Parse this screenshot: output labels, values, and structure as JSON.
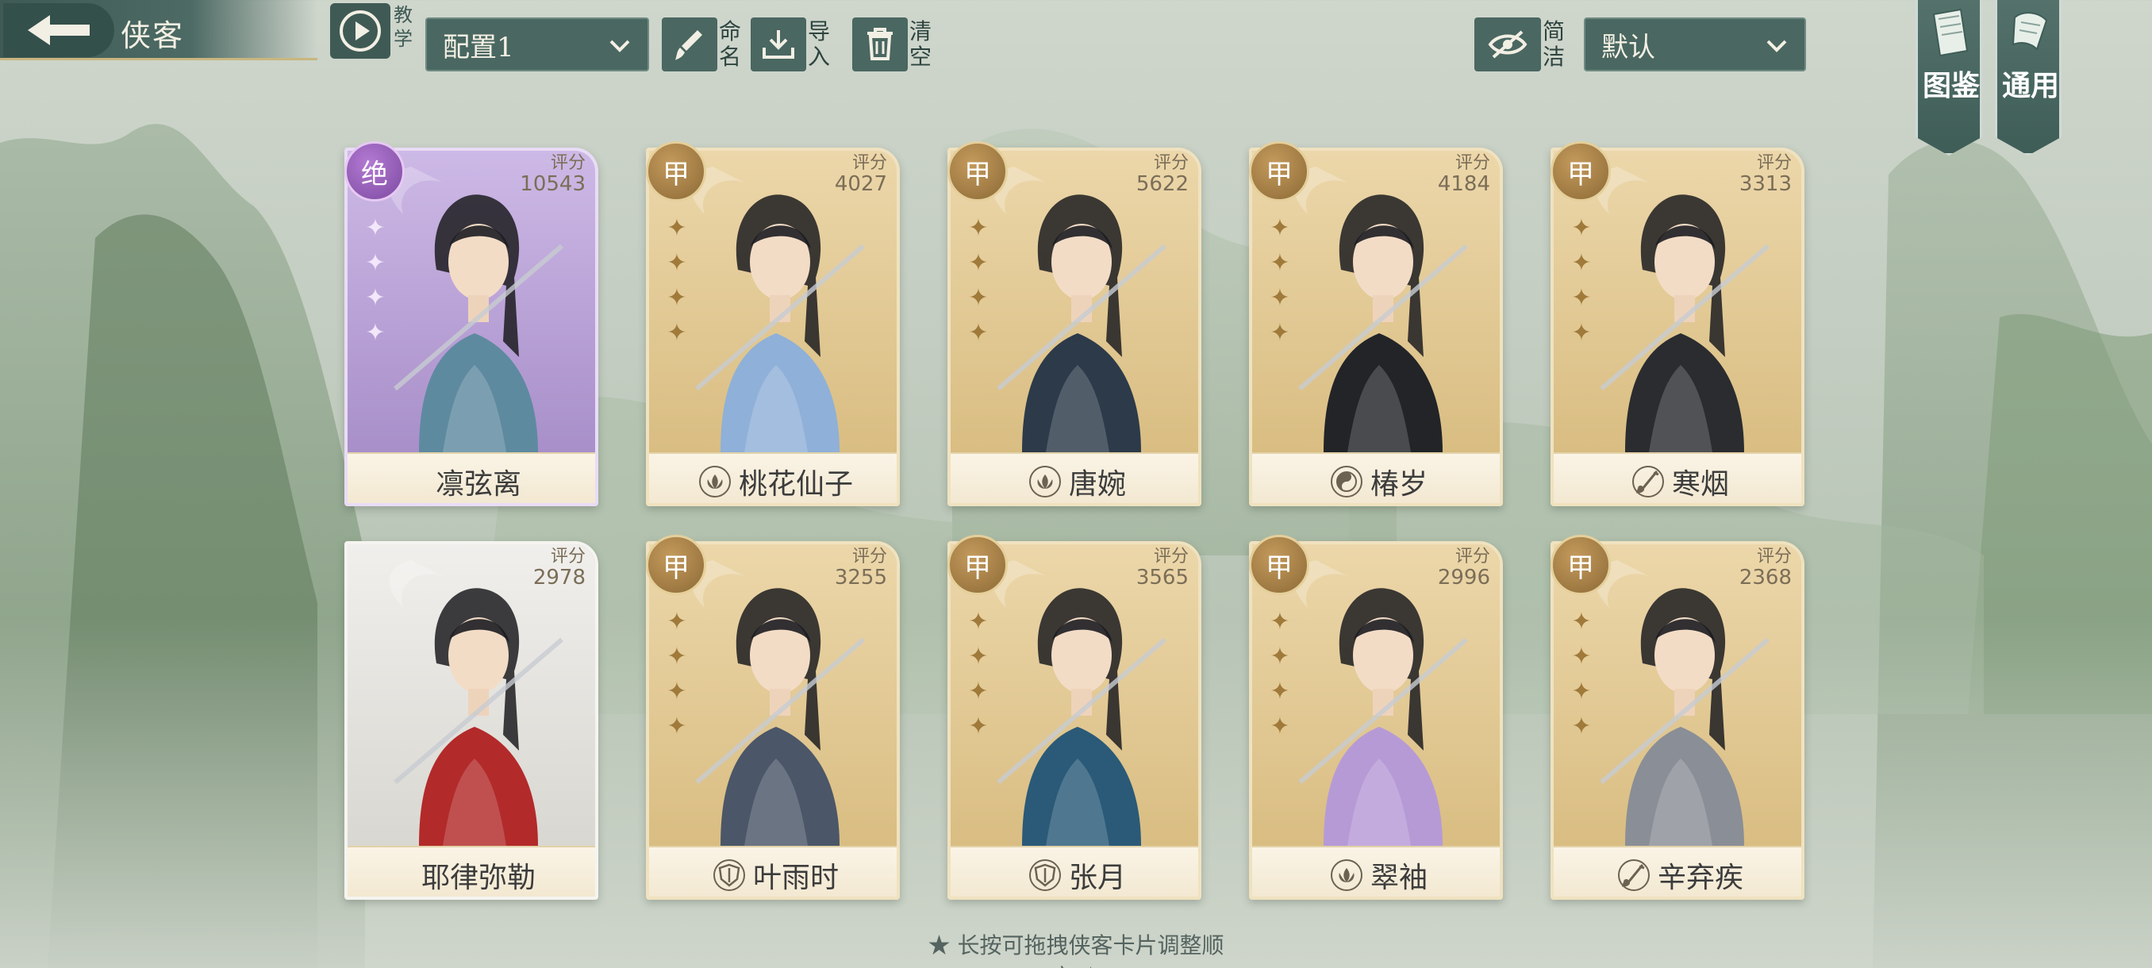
{
  "header": {
    "title": "侠客",
    "tutorial_label": "教学",
    "config_select": "配置1",
    "rename_label": "命名",
    "import_label": "导入",
    "clear_label": "清空",
    "simple_label": "简洁",
    "sort_select": "默认",
    "codex_label": "图鉴",
    "general_label": "通用"
  },
  "cards": [
    {
      "name": "凛弦离",
      "score_label": "评分",
      "score": "10543",
      "rank": "绝",
      "rank_style": "purple",
      "sect_icon": "",
      "theme": "#b9a6d6",
      "robe": "#5e8aa0"
    },
    {
      "name": "桃花仙子",
      "score_label": "评分",
      "score": "4027",
      "rank": "甲",
      "rank_style": "gold",
      "sect_icon": "lotus-icon",
      "theme": "#e5cfa0",
      "robe": "#8fb0d8"
    },
    {
      "name": "唐婉",
      "score_label": "评分",
      "score": "5622",
      "rank": "甲",
      "rank_style": "gold",
      "sect_icon": "lotus-icon",
      "theme": "#e5cfa0",
      "robe": "#2c3a4a"
    },
    {
      "name": "椿岁",
      "score_label": "评分",
      "score": "4184",
      "rank": "甲",
      "rank_style": "gold",
      "sect_icon": "yin-yang-icon",
      "theme": "#e5cfa0",
      "robe": "#222428"
    },
    {
      "name": "寒烟",
      "score_label": "评分",
      "score": "3313",
      "rank": "甲",
      "rank_style": "gold",
      "sect_icon": "brush-icon",
      "theme": "#e5cfa0",
      "robe": "#2a2c30"
    },
    {
      "name": "耶律弥勒",
      "score_label": "评分",
      "score": "2978",
      "rank": "",
      "rank_style": "none",
      "sect_icon": "",
      "theme": "#e6e4df",
      "robe": "#b32a2a"
    },
    {
      "name": "叶雨时",
      "score_label": "评分",
      "score": "3255",
      "rank": "甲",
      "rank_style": "gold",
      "sect_icon": "shield-icon",
      "theme": "#e5cfa0",
      "robe": "#4b5668"
    },
    {
      "name": "张月",
      "score_label": "评分",
      "score": "3565",
      "rank": "甲",
      "rank_style": "gold",
      "sect_icon": "shield-icon",
      "theme": "#e5cfa0",
      "robe": "#2a5a78"
    },
    {
      "name": "翠袖",
      "score_label": "评分",
      "score": "2996",
      "rank": "甲",
      "rank_style": "gold",
      "sect_icon": "lotus-icon",
      "theme": "#e5cfa0",
      "robe": "#b69ad6"
    },
    {
      "name": "辛弃疾",
      "score_label": "评分",
      "score": "2368",
      "rank": "甲",
      "rank_style": "gold",
      "sect_icon": "brush-icon",
      "theme": "#e5cfa0",
      "robe": "#8a8e96"
    }
  ],
  "footer": {
    "hint": "★ 长按可拖拽侠客卡片调整顺序 ★"
  }
}
